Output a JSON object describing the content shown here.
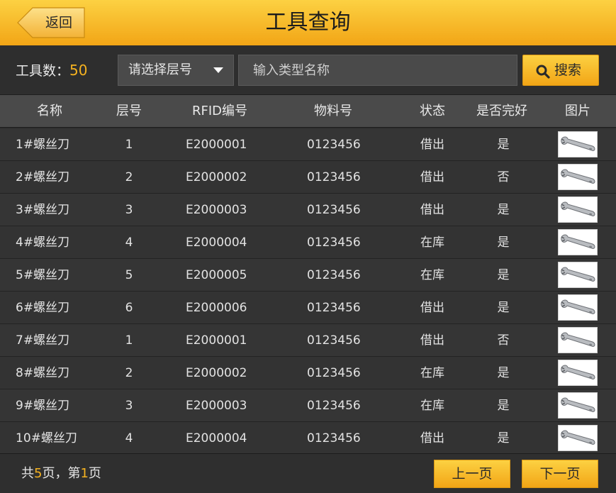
{
  "header": {
    "title": "工具查询",
    "back_label": "返回"
  },
  "toolbar": {
    "count_label": "工具数：",
    "count_value": "50",
    "layer_select_label": "请选择层号",
    "search_placeholder": "输入类型名称",
    "search_label": "搜索"
  },
  "table": {
    "columns": [
      "名称",
      "层号",
      "RFID编号",
      "物料号",
      "状态",
      "是否完好",
      "图片"
    ],
    "rows": [
      {
        "name": "1#螺丝刀",
        "layer": "1",
        "rfid": "E2000001",
        "material": "0123456",
        "status": "借出",
        "ok": "是"
      },
      {
        "name": "2#螺丝刀",
        "layer": "2",
        "rfid": "E2000002",
        "material": "0123456",
        "status": "借出",
        "ok": "否"
      },
      {
        "name": "3#螺丝刀",
        "layer": "3",
        "rfid": "E2000003",
        "material": "0123456",
        "status": "借出",
        "ok": "是"
      },
      {
        "name": "4#螺丝刀",
        "layer": "4",
        "rfid": "E2000004",
        "material": "0123456",
        "status": "在库",
        "ok": "是"
      },
      {
        "name": "5#螺丝刀",
        "layer": "5",
        "rfid": "E2000005",
        "material": "0123456",
        "status": "在库",
        "ok": "是"
      },
      {
        "name": "6#螺丝刀",
        "layer": "6",
        "rfid": "E2000006",
        "material": "0123456",
        "status": "借出",
        "ok": "是"
      },
      {
        "name": "7#螺丝刀",
        "layer": "1",
        "rfid": "E2000001",
        "material": "0123456",
        "status": "借出",
        "ok": "否"
      },
      {
        "name": "8#螺丝刀",
        "layer": "2",
        "rfid": "E2000002",
        "material": "0123456",
        "status": "在库",
        "ok": "是"
      },
      {
        "name": "9#螺丝刀",
        "layer": "3",
        "rfid": "E2000003",
        "material": "0123456",
        "status": "在库",
        "ok": "是"
      },
      {
        "name": "10#螺丝刀",
        "layer": "4",
        "rfid": "E2000004",
        "material": "0123456",
        "status": "借出",
        "ok": "是"
      }
    ]
  },
  "footer": {
    "pager_prefix": "共",
    "total_pages": "5",
    "pager_middle": "页，第",
    "current_page": "1",
    "pager_suffix": "页",
    "prev_label": "上一页",
    "next_label": "下一页"
  },
  "colors": {
    "accent": "#f5b220",
    "header_top": "#fcd142",
    "header_bottom": "#f2a516"
  },
  "icons": {
    "search": "search-icon",
    "back": "back-arrow-icon",
    "thumb": "wrench-icon"
  }
}
